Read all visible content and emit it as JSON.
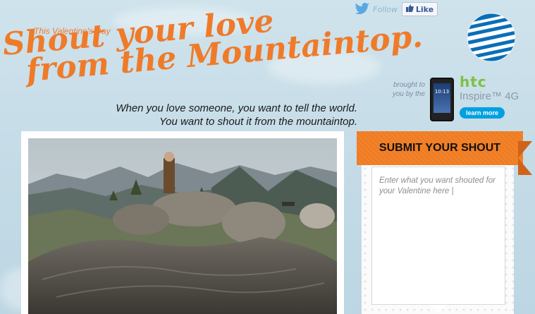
{
  "social": {
    "follow_label": "Follow",
    "twitter_icon": "twitter-bird-icon",
    "like_label": "Like",
    "facebook_icon": "facebook-thumb-icon"
  },
  "header": {
    "kicker": "This Valentine's Day",
    "title_line1": "Shout your love",
    "title_line2": "from the Mountaintop.",
    "tagline_line1": "When you love someone, you want to tell the world.",
    "tagline_line2": "You want to shout it from the mountaintop."
  },
  "sponsor": {
    "brought_line1": "brought to",
    "brought_line2": "you by the",
    "brand": "htc",
    "model": "Inspire™ 4G",
    "learn_more": "learn more",
    "phone_clock": "10:13"
  },
  "submit": {
    "heading": "SUBMIT YOUR SHOUT",
    "placeholder": "Enter what you want shouted for your Valentine here |"
  },
  "colors": {
    "accent_orange": "#f07c22",
    "title_orange": "#ef7b2a",
    "htc_green": "#7cc242",
    "att_blue": "#00a1e0"
  }
}
